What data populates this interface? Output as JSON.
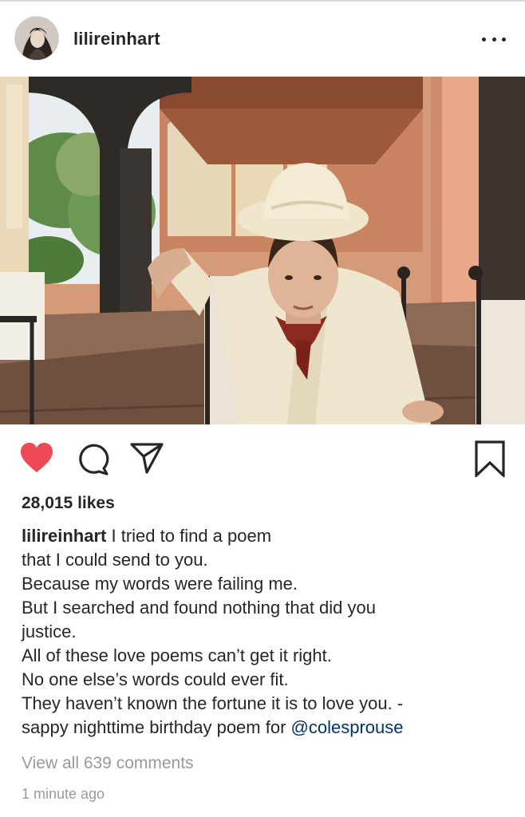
{
  "post": {
    "username": "lilireinhart",
    "likes_text": "28,015 likes",
    "caption": {
      "user": "lilireinhart",
      "first_line": "I tried to find a poem",
      "lines": [
        "that I could send to you.",
        "Because my words were failing me.",
        "But I searched and found nothing that did you",
        "justice.",
        "All of these love poems can’t get it right.",
        "No one else’s words could ever fit.",
        "They haven’t known the fortune it is to love you. -"
      ],
      "last_line_prefix": "sappy nighttime birthday poem for ",
      "mention": "@colesprouse"
    },
    "view_comments": "View all 639 comments",
    "timestamp": "1 minute ago",
    "liked": true
  },
  "icons": {
    "more": "more-options-icon",
    "like": "heart-icon",
    "comment": "comment-icon",
    "share": "share-icon",
    "save": "bookmark-icon"
  },
  "colors": {
    "like_red": "#ed4956",
    "text": "#262626",
    "muted": "#999999",
    "mention": "#003569"
  }
}
